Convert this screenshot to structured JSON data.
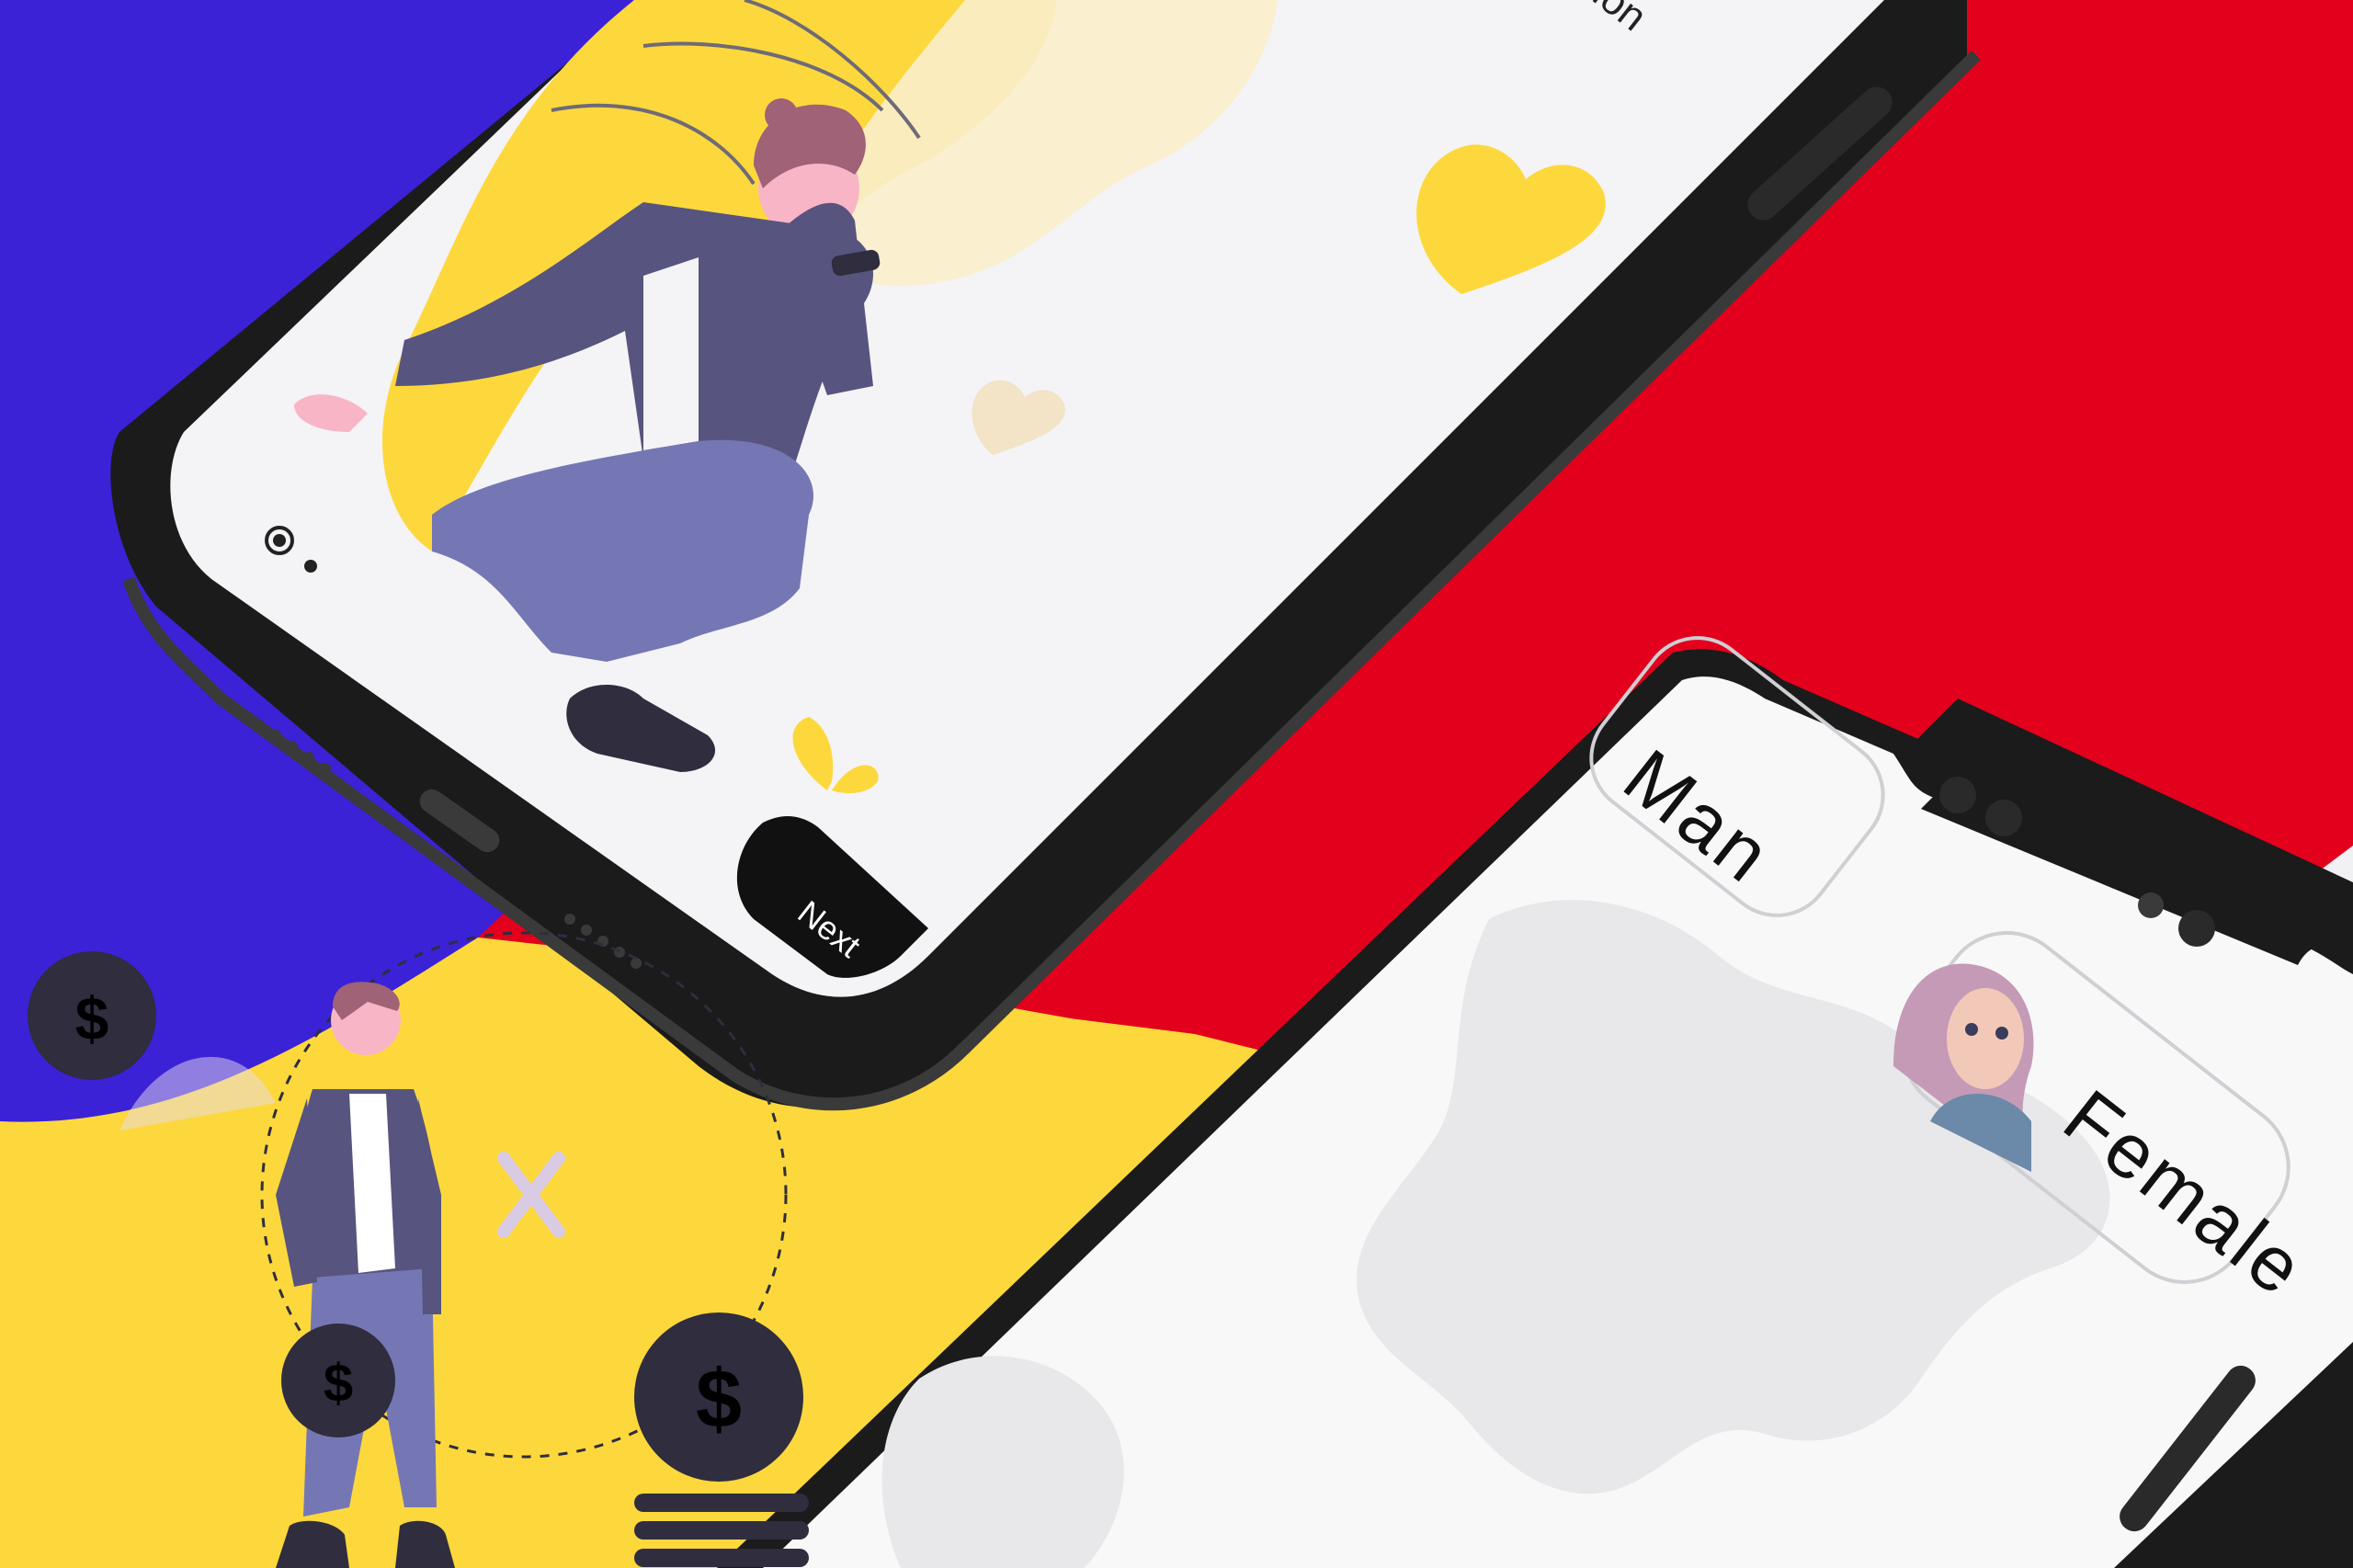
{
  "screen1": {
    "header_text_partial": "ution",
    "next_button_label": "Next",
    "pager_dots": 2
  },
  "screen2": {
    "option_man_label": "Man",
    "option_female_label": "Female"
  },
  "coins": {
    "symbol": "$"
  },
  "colors": {
    "blue": "#3b22d6",
    "yellow": "#fdd83c",
    "red": "#e2001c",
    "phone_frame": "#1b1b1b",
    "screen_light": "#f4f3f6",
    "coin_dark": "#2f2d3e"
  },
  "icons": [
    "heart-icon",
    "dollar-coin-icon",
    "close-x-icon",
    "camera-icon",
    "world-map"
  ]
}
